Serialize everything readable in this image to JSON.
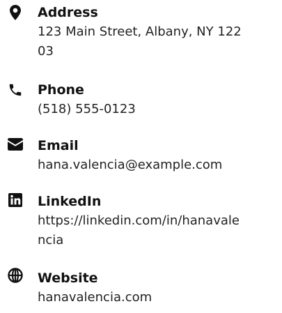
{
  "contact": {
    "items": [
      {
        "icon": "map-pin-icon",
        "label": "Address",
        "value": "123 Main Street, Albany, NY 12203"
      },
      {
        "icon": "phone-icon",
        "label": "Phone",
        "value": "(518) 555-0123"
      },
      {
        "icon": "envelope-icon",
        "label": "Email",
        "value": "hana.valencia@example.com"
      },
      {
        "icon": "linkedin-icon",
        "label": "LinkedIn",
        "value": "https://linkedin.com/in/hanavalencia"
      },
      {
        "icon": "globe-icon",
        "label": "Website",
        "value": "hanavalencia.com"
      }
    ]
  },
  "colors": {
    "text": "#111111",
    "icon": "#111111",
    "background": "#ffffff"
  }
}
